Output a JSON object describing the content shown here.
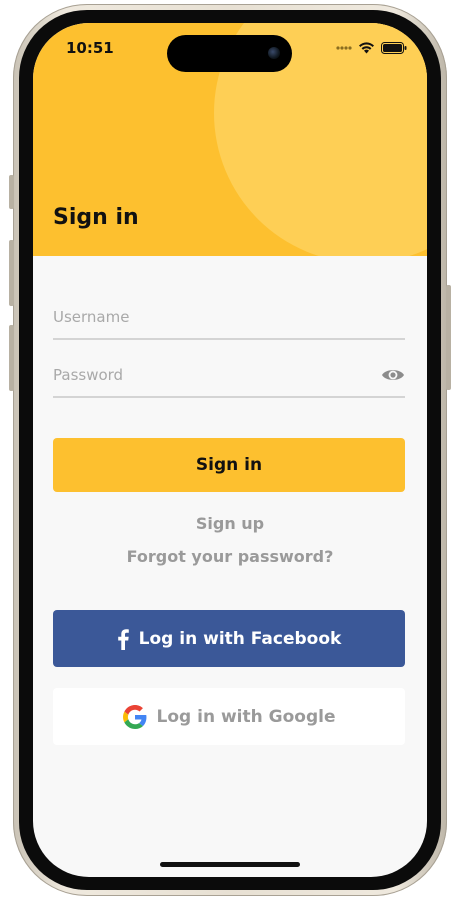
{
  "status_bar": {
    "time": "10:51",
    "icons": [
      "signal-dots-icon",
      "wifi-icon",
      "battery-icon"
    ]
  },
  "header": {
    "title": "Sign in"
  },
  "form": {
    "username": {
      "placeholder": "Username",
      "value": ""
    },
    "password": {
      "placeholder": "Password",
      "value": "",
      "toggle_icon": "eye-icon"
    }
  },
  "actions": {
    "sign_in_label": "Sign in",
    "sign_up_label": "Sign up",
    "forgot_label": "Forgot your password?",
    "facebook_label": "Log in with Facebook",
    "google_label": "Log in with Google"
  },
  "colors": {
    "accent": "#fdc02f",
    "header_circle": "#fecf55",
    "facebook": "#3b5898",
    "link_gray": "#9a9a9a"
  }
}
